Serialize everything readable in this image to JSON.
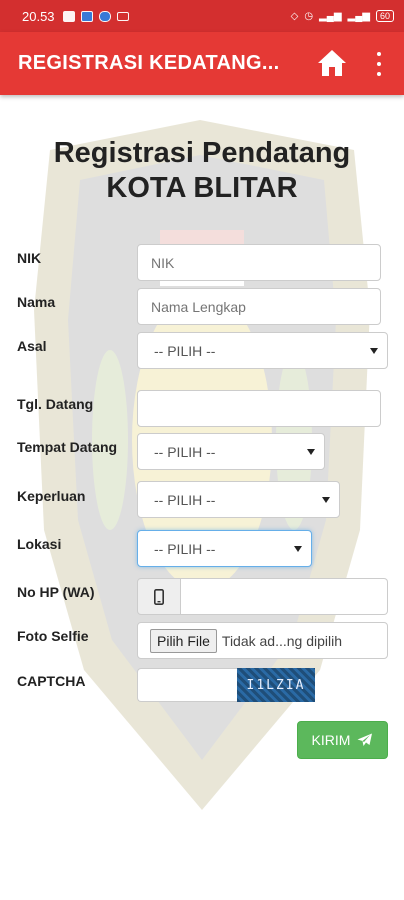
{
  "status_bar": {
    "time": "20.53",
    "battery": "60"
  },
  "app_bar": {
    "title": "REGISTRASI KEDATANG...",
    "home_icon": "home-icon",
    "menu_icon": "more-vert-icon"
  },
  "form": {
    "heading_line1": "Registrasi Pendatang",
    "heading_line2": "KOTA BLITAR",
    "fields": {
      "nik": {
        "label": "NIK",
        "placeholder": "NIK"
      },
      "nama": {
        "label": "Nama",
        "placeholder": "Nama Lengkap"
      },
      "asal": {
        "label": "Asal",
        "value": "-- PILIH --"
      },
      "tgl_datang": {
        "label": "Tgl. Datang",
        "value": ""
      },
      "tempat_datang": {
        "label": "Tempat Datang",
        "value": "-- PILIH --"
      },
      "keperluan": {
        "label": "Keperluan",
        "value": "-- PILIH --"
      },
      "lokasi": {
        "label": "Lokasi",
        "value": "-- PILIH --"
      },
      "no_hp": {
        "label": "No HP (WA)",
        "icon": "mobile-phone-icon"
      },
      "foto_selfie": {
        "label": "Foto Selfie",
        "button": "Pilih File",
        "status": "Tidak ad...ng dipilih"
      },
      "captcha": {
        "label": "CAPTCHA",
        "image_text": "I1LZIA"
      }
    },
    "submit_label": "KIRIM",
    "submit_icon": "send-icon"
  },
  "colors": {
    "status_bar": "#d32f2f",
    "app_bar": "#e53935",
    "submit": "#5cb85c"
  }
}
